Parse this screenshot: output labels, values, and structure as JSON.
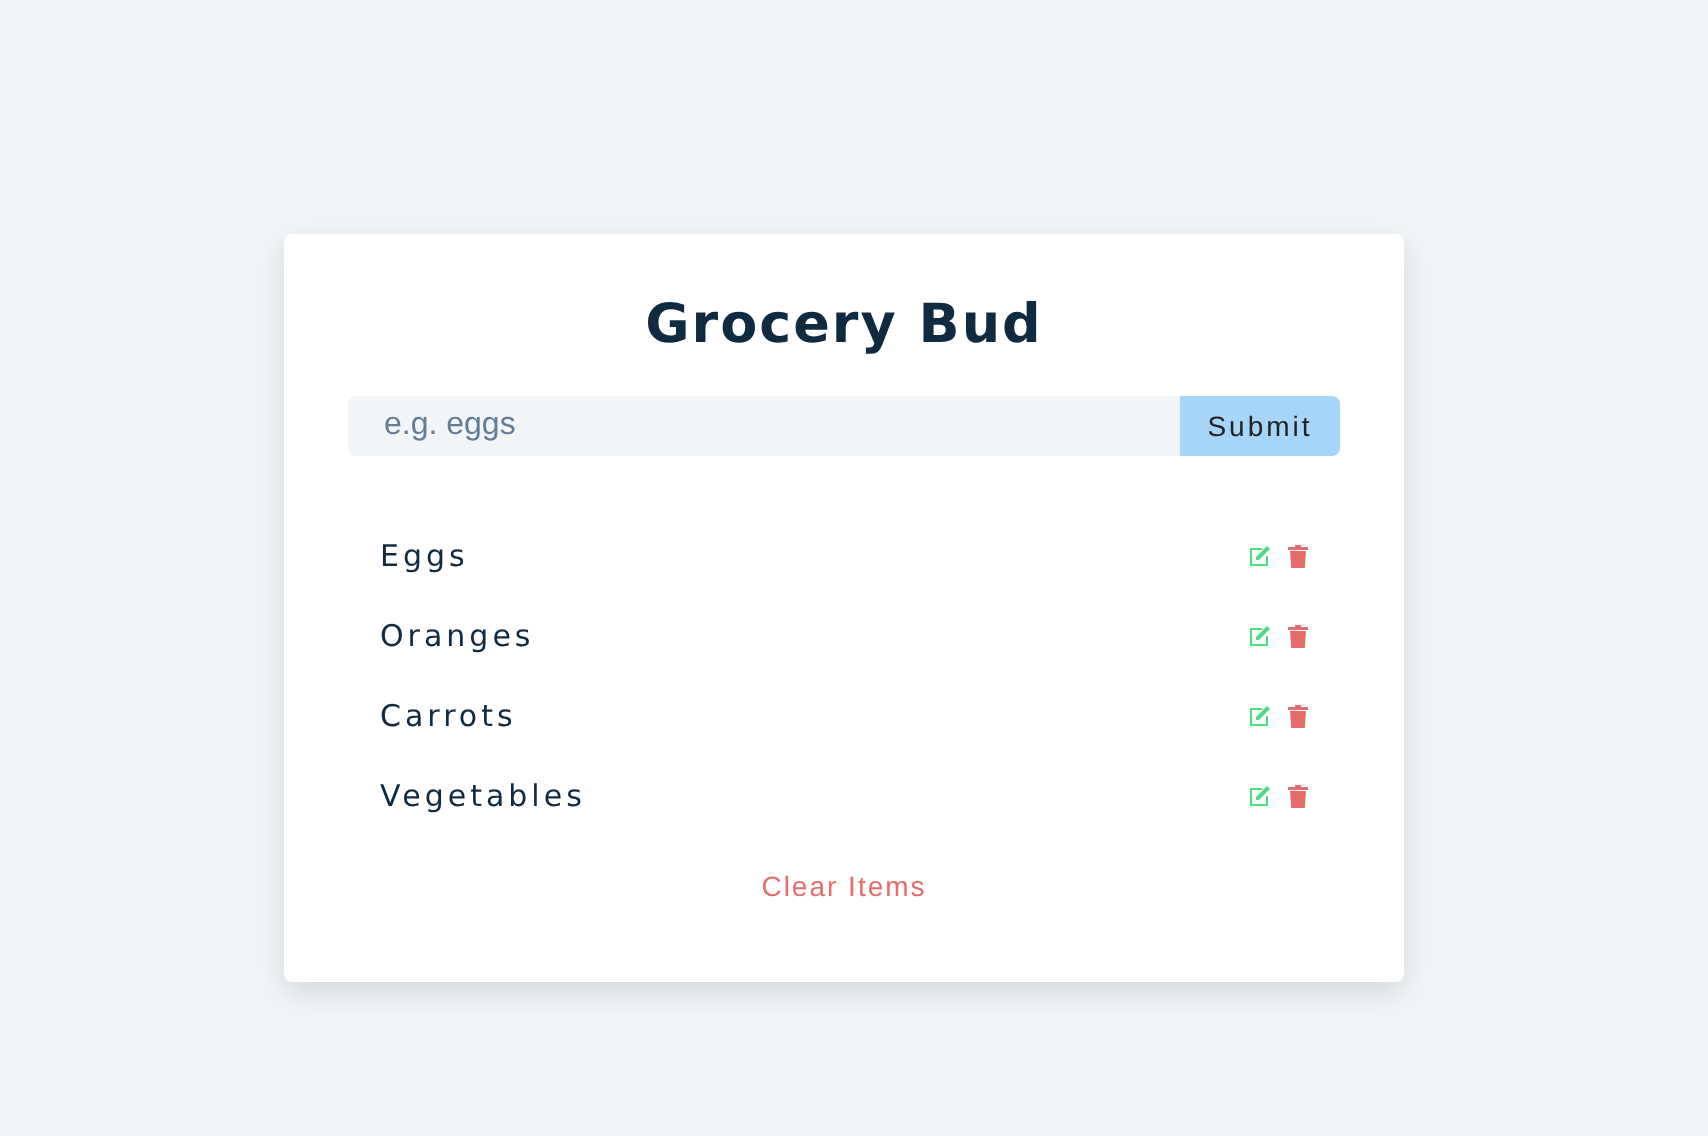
{
  "title": "Grocery Bud",
  "form": {
    "placeholder": "e.g. eggs",
    "button": "Submit"
  },
  "items": [
    {
      "name": "Eggs"
    },
    {
      "name": "Oranges"
    },
    {
      "name": "Carrots"
    },
    {
      "name": "Vegetables"
    }
  ],
  "clear_button": "Clear Items"
}
